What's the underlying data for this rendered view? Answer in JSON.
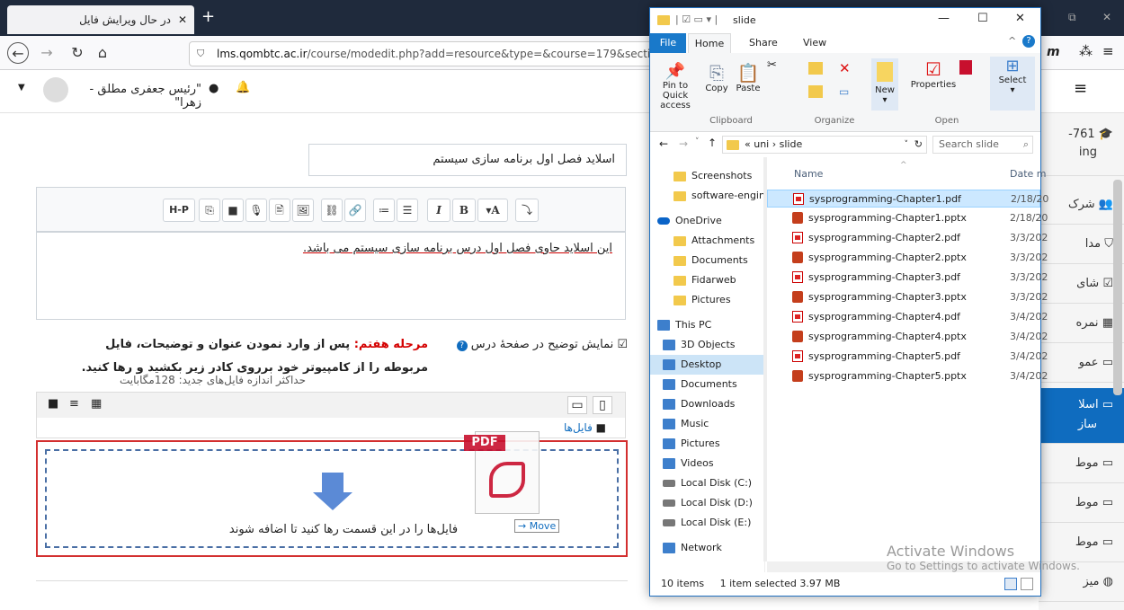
{
  "browser": {
    "tab_title": "در حال ویرایش فایل",
    "tab_close": "✕",
    "new_tab": "+",
    "url": "lms.qombtc.ac.ir/course/modedit.php?add=resource&type=&course=179&section",
    "url_domain": "lms.qombtc.ac.ir",
    "url_path": "/course/modedit.php?add=resource&type=&course=179&section"
  },
  "header": {
    "user_name": "\"رئیس جعفری مطلق - زهرا\"",
    "right_letter": "m"
  },
  "form": {
    "name_value": "اسلاید فصل اول برنامه سازی سیستم",
    "editor_text": "این اسلاید حاوی فصل اول درس برنامه سازی سیستم می باشد.",
    "editor_buttons": [
      "H-P",
      "⎘",
      "■",
      "🎙",
      "🖹",
      "🖼",
      "⛓",
      "🔗",
      "≔",
      "☰",
      "I",
      "B",
      "▾A",
      "⤵"
    ],
    "checkbox_label": "نمایش توضیح در صفحهٔ درس",
    "step_label": "مرحله هفتم:",
    "step_text_1": "پس از وارد نمودن عنوان و توضیحات، فایل",
    "step_text_2": "مربوطه را از کامپیوتر خود برروی کادر زیر بکشید و رها کنید.",
    "max_size": "حداکثر اندازه فایل‌های جدید: 128مگابایت",
    "files_folder": "فایل‌ها",
    "drop_text": "فایل‌ها را در این قسمت رها کنید تا اضافه شوند",
    "drag_pdf": "PDF",
    "drag_move": "→ Move"
  },
  "sidebar": {
    "items": [
      {
        "label": "761-",
        "sub": "ing"
      },
      {
        "label": "شرک"
      },
      {
        "label": "مدا"
      },
      {
        "label": "شای"
      },
      {
        "label": "نمره"
      },
      {
        "label": "عمو"
      },
      {
        "label": "اسلا",
        "sub": "ساز"
      },
      {
        "label": "موط"
      },
      {
        "label": "موط"
      },
      {
        "label": "موط"
      },
      {
        "label": "میز"
      }
    ]
  },
  "explorer": {
    "title": "slide",
    "ribbon_tabs": [
      "File",
      "Home",
      "Share",
      "View"
    ],
    "clipboard": {
      "pin": "Pin to Quick access",
      "copy": "Copy",
      "paste": "Paste",
      "group": "Clipboard"
    },
    "organize": {
      "group": "Organize"
    },
    "open": {
      "new": "New",
      "properties": "Properties",
      "group": "Open"
    },
    "select": {
      "label": "Select"
    },
    "address": "« uni › slide",
    "search_placeholder": "Search slide",
    "col_name": "Name",
    "col_date": "Date m",
    "nav": [
      {
        "label": "Screenshots",
        "icon": "folder"
      },
      {
        "label": "software-engine",
        "icon": "folder"
      },
      {
        "label": "OneDrive",
        "icon": "cloud"
      },
      {
        "label": "Attachments",
        "icon": "folder"
      },
      {
        "label": "Documents",
        "icon": "folder"
      },
      {
        "label": "Fidarweb",
        "icon": "folder"
      },
      {
        "label": "Pictures",
        "icon": "folder"
      },
      {
        "label": "This PC",
        "icon": "pc"
      },
      {
        "label": "3D Objects",
        "icon": "blue"
      },
      {
        "label": "Desktop",
        "icon": "blue"
      },
      {
        "label": "Documents",
        "icon": "blue"
      },
      {
        "label": "Downloads",
        "icon": "blue"
      },
      {
        "label": "Music",
        "icon": "blue"
      },
      {
        "label": "Pictures",
        "icon": "blue"
      },
      {
        "label": "Videos",
        "icon": "blue"
      },
      {
        "label": "Local Disk (C:)",
        "icon": "drive"
      },
      {
        "label": "Local Disk (D:)",
        "icon": "drive"
      },
      {
        "label": "Local Disk (E:)",
        "icon": "drive"
      },
      {
        "label": "Network",
        "icon": "blue"
      }
    ],
    "files": [
      {
        "name": "sysprogramming-Chapter1.pdf",
        "date": "2/18/20",
        "type": "pdf"
      },
      {
        "name": "sysprogramming-Chapter1.pptx",
        "date": "2/18/20",
        "type": "ppt"
      },
      {
        "name": "sysprogramming-Chapter2.pdf",
        "date": "3/3/202",
        "type": "pdf"
      },
      {
        "name": "sysprogramming-Chapter2.pptx",
        "date": "3/3/202",
        "type": "ppt"
      },
      {
        "name": "sysprogramming-Chapter3.pdf",
        "date": "3/3/202",
        "type": "pdf"
      },
      {
        "name": "sysprogramming-Chapter3.pptx",
        "date": "3/3/202",
        "type": "ppt"
      },
      {
        "name": "sysprogramming-Chapter4.pdf",
        "date": "3/4/202",
        "type": "pdf"
      },
      {
        "name": "sysprogramming-Chapter4.pptx",
        "date": "3/4/202",
        "type": "ppt"
      },
      {
        "name": "sysprogramming-Chapter5.pdf",
        "date": "3/4/202",
        "type": "pdf"
      },
      {
        "name": "sysprogramming-Chapter5.pptx",
        "date": "3/4/202",
        "type": "ppt"
      }
    ],
    "status_items": "10 items",
    "status_selected": "1 item selected  3.97 MB"
  },
  "watermark": {
    "line1": "Activate Windows",
    "line2": "Go to Settings to activate Windows."
  },
  "colors": {
    "accent": "#0f6cbf",
    "drop_border": "#d32f2f",
    "step_red": "#d40000",
    "titlebar": "#1f2a3c"
  }
}
